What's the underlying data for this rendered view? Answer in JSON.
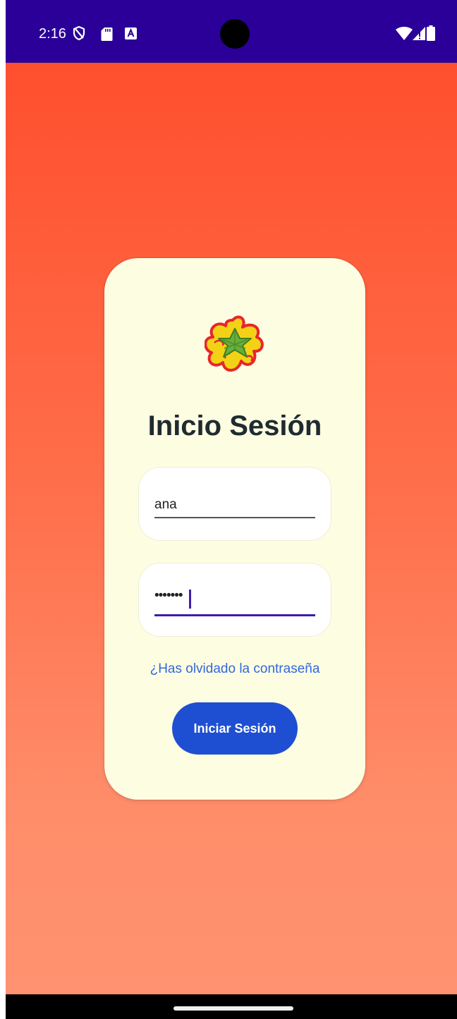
{
  "status_bar": {
    "time": "2:16",
    "left_icons": [
      "shield-slash-icon",
      "sd-card-icon",
      "a-badge-icon"
    ],
    "right_icons": [
      "wifi-icon",
      "cellular-signal-icon",
      "battery-icon"
    ],
    "background_color": "#2a0098"
  },
  "login": {
    "logo_icon": "star-fruit-logo-icon",
    "title": "Inicio Sesión",
    "username_value": "ana",
    "password_mask": "•••••••",
    "forgot_password_link": "¿Has olvidado la contraseña",
    "submit_label": "Iniciar Sesión"
  },
  "colors": {
    "gradient_top": "#ff4f2e",
    "gradient_bottom": "#ff9270",
    "card_background": "#fdfde2",
    "title_color": "#1f2b30",
    "link_color": "#3367dd",
    "button_color": "#1e4fd2",
    "focus_color": "#3d1fa8"
  }
}
